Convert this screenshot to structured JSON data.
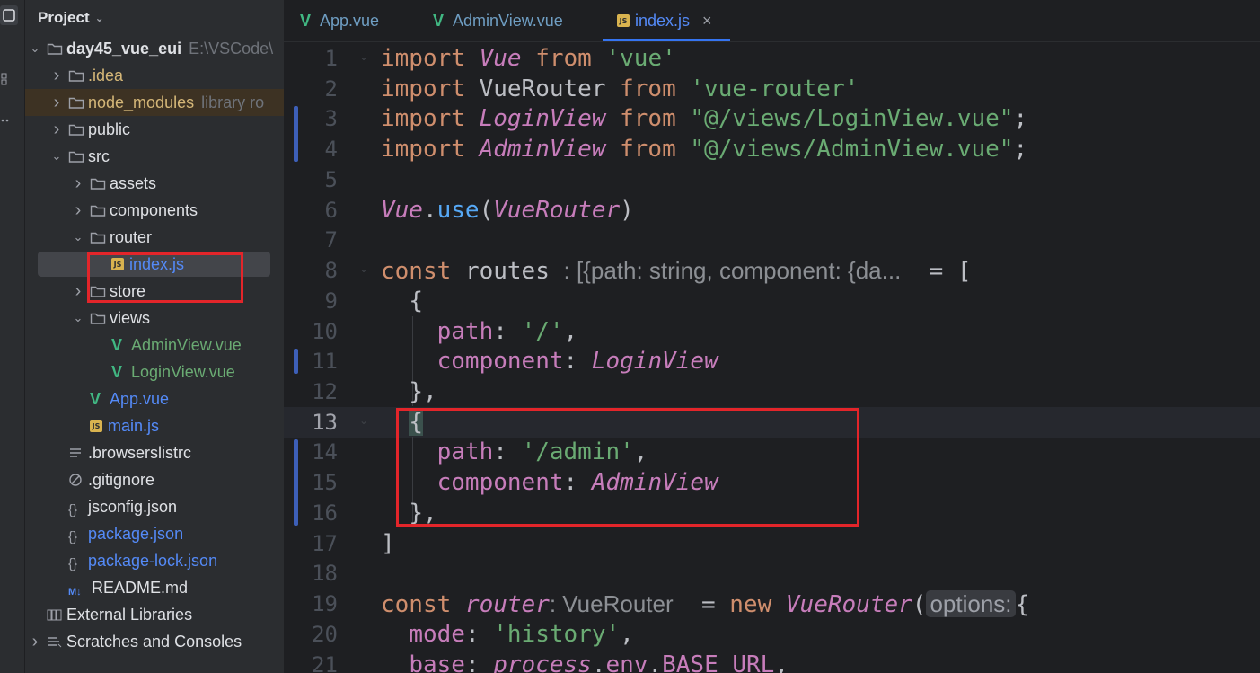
{
  "project_panel": {
    "title": "Project",
    "tree": [
      {
        "label": "day45_vue_eui",
        "suffix": "E:\\VSCode\\",
        "icon": "module-folder-icon",
        "expanded": true,
        "bold": true
      },
      {
        "label": ".idea",
        "icon": "folder-icon",
        "color": "#d5b778"
      },
      {
        "label": "node_modules",
        "suffix": "library ro",
        "icon": "folder-icon",
        "color": "#d5b778",
        "excluded": true
      },
      {
        "label": "public",
        "icon": "folder-icon"
      },
      {
        "label": "src",
        "icon": "folder-icon",
        "expanded": true
      },
      {
        "label": "assets",
        "icon": "folder-icon"
      },
      {
        "label": "components",
        "icon": "folder-icon"
      },
      {
        "label": "router",
        "icon": "folder-icon",
        "expanded": true
      },
      {
        "label": "index.js",
        "icon": "js-file-icon",
        "selected": true,
        "color": "#548af7"
      },
      {
        "label": "store",
        "icon": "folder-icon"
      },
      {
        "label": "views",
        "icon": "folder-icon",
        "expanded": true
      },
      {
        "label": "AdminView.vue",
        "icon": "vue-file-icon",
        "color": "#6aab73"
      },
      {
        "label": "LoginView.vue",
        "icon": "vue-file-icon",
        "color": "#6aab73"
      },
      {
        "label": "App.vue",
        "icon": "vue-file-icon",
        "color": "#548af7"
      },
      {
        "label": "main.js",
        "icon": "js-file-icon",
        "color": "#548af7"
      },
      {
        "label": ".browserslistrc",
        "icon": "text-file-icon"
      },
      {
        "label": ".gitignore",
        "icon": "ignore-file-icon"
      },
      {
        "label": "jsconfig.json",
        "icon": "json-file-icon"
      },
      {
        "label": "package.json",
        "icon": "json-file-icon",
        "color": "#548af7"
      },
      {
        "label": "package-lock.json",
        "icon": "json-file-icon",
        "color": "#548af7"
      },
      {
        "label": "README.md",
        "icon": "markdown-file-icon"
      },
      {
        "label": "External Libraries",
        "icon": "library-icon"
      },
      {
        "label": "Scratches and Consoles",
        "icon": "scratches-icon"
      }
    ]
  },
  "tabs": [
    {
      "label": "App.vue",
      "icon": "vue-file-icon",
      "active": false
    },
    {
      "label": "AdminView.vue",
      "icon": "vue-file-icon",
      "active": false
    },
    {
      "label": "index.js",
      "icon": "js-file-icon",
      "active": true,
      "close": "×"
    }
  ],
  "line_numbers": [
    "1",
    "2",
    "3",
    "4",
    "5",
    "6",
    "7",
    "8",
    "9",
    "10",
    "11",
    "12",
    "13",
    "14",
    "15",
    "16",
    "17",
    "18",
    "19",
    "20",
    "21"
  ],
  "current_line": "13",
  "code_tokens": {
    "l1": [
      "import",
      "Vue",
      "from",
      "'vue'"
    ],
    "l2": [
      "import",
      "VueRouter",
      "from",
      "'vue-router'"
    ],
    "l3": [
      "import",
      "LoginView",
      "from",
      "\"@/views/LoginView.vue\"",
      ";"
    ],
    "l4": [
      "import",
      "AdminView",
      "from",
      "\"@/views/AdminView.vue\"",
      ";"
    ],
    "l6": [
      "Vue",
      ".",
      "use",
      "(",
      "VueRouter",
      ")"
    ],
    "l8": [
      "const",
      "routes",
      ": [{path: string, component: {da...",
      "= ["
    ],
    "l9": [
      "{"
    ],
    "l10": [
      "path",
      ": ",
      "'/'",
      ","
    ],
    "l11": [
      "component",
      ": ",
      "LoginView"
    ],
    "l12": [
      "},"
    ],
    "l13": [
      "{"
    ],
    "l14": [
      "path",
      ": ",
      "'/admin'",
      ","
    ],
    "l15": [
      "component",
      ": ",
      "AdminView"
    ],
    "l16": [
      "},"
    ],
    "l17": [
      "]"
    ],
    "l19": [
      "const",
      "router",
      ": VueRouter",
      "=",
      "new",
      "VueRouter",
      "(",
      "options:",
      "{"
    ],
    "l20": [
      "mode",
      ": ",
      "'history'",
      ","
    ],
    "l21": [
      "base",
      ": ",
      "process",
      ".",
      "env",
      ".",
      "BASE_URL",
      ","
    ]
  },
  "colors": {
    "keyword": "#cf8e6d",
    "string": "#6aab73",
    "identifier_italic": "#c77dbb",
    "function": "#56a8f5",
    "highlight_box": "#e3252a",
    "selection": "#43454a"
  }
}
